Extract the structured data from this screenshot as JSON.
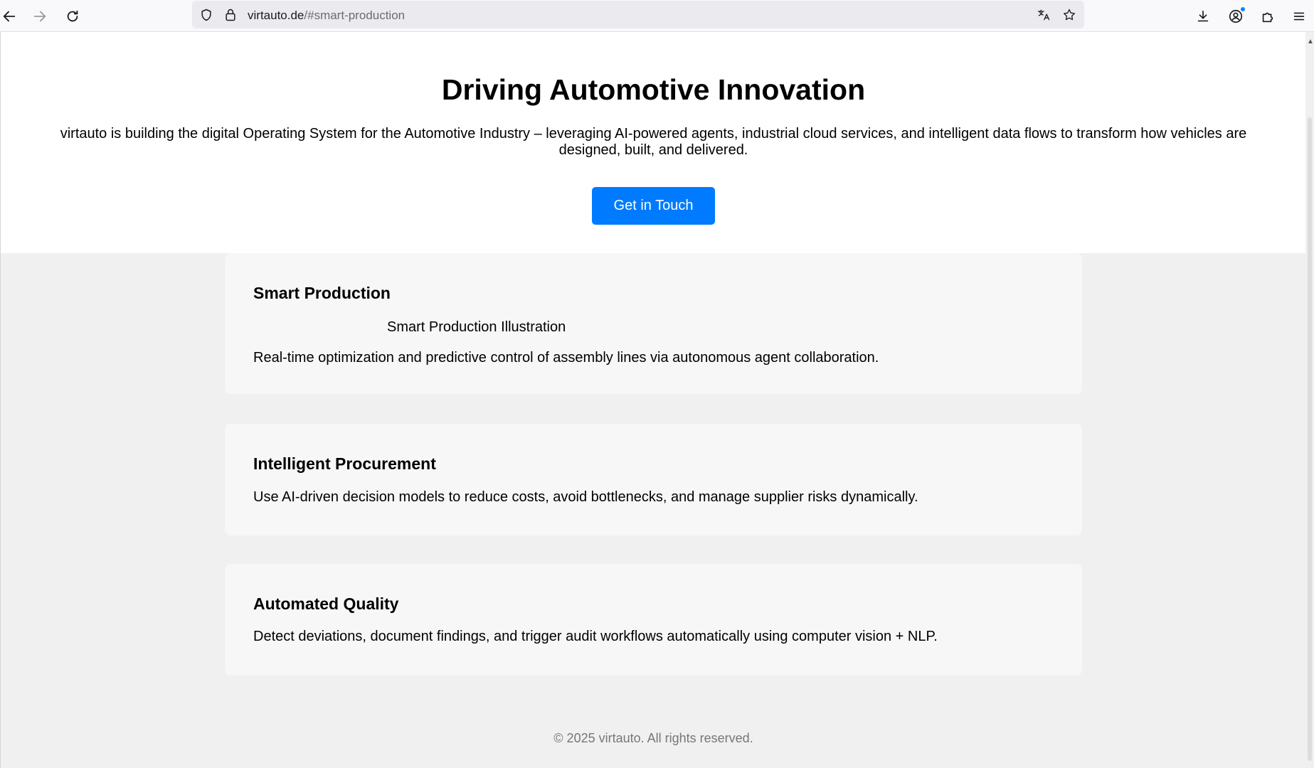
{
  "browser": {
    "url_host": "virtauto.de",
    "url_path": "/#smart-production"
  },
  "hero": {
    "title": "Driving Automotive Innovation",
    "subtitle": "virtauto is building the digital Operating System for the Automotive Industry – leveraging AI-powered agents, industrial cloud services, and intelligent data flows to transform how vehicles are designed, built, and delivered.",
    "cta_label": "Get in Touch"
  },
  "features": [
    {
      "title": "Smart Production",
      "illustration_alt": "Smart Production Illustration",
      "description": "Real-time optimization and predictive control of assembly lines via autonomous agent collaboration."
    },
    {
      "title": "Intelligent Procurement",
      "description": "Use AI-driven decision models to reduce costs, avoid bottlenecks, and manage supplier risks dynamically."
    },
    {
      "title": "Automated Quality",
      "description": "Detect deviations, document findings, and trigger audit workflows automatically using computer vision + NLP."
    }
  ],
  "footer": {
    "text": "© 2025 virtauto. All rights reserved."
  },
  "colors": {
    "accent": "#007bff",
    "card_bg": "#f7f7f7",
    "page_bg": "#f0f0f0"
  }
}
